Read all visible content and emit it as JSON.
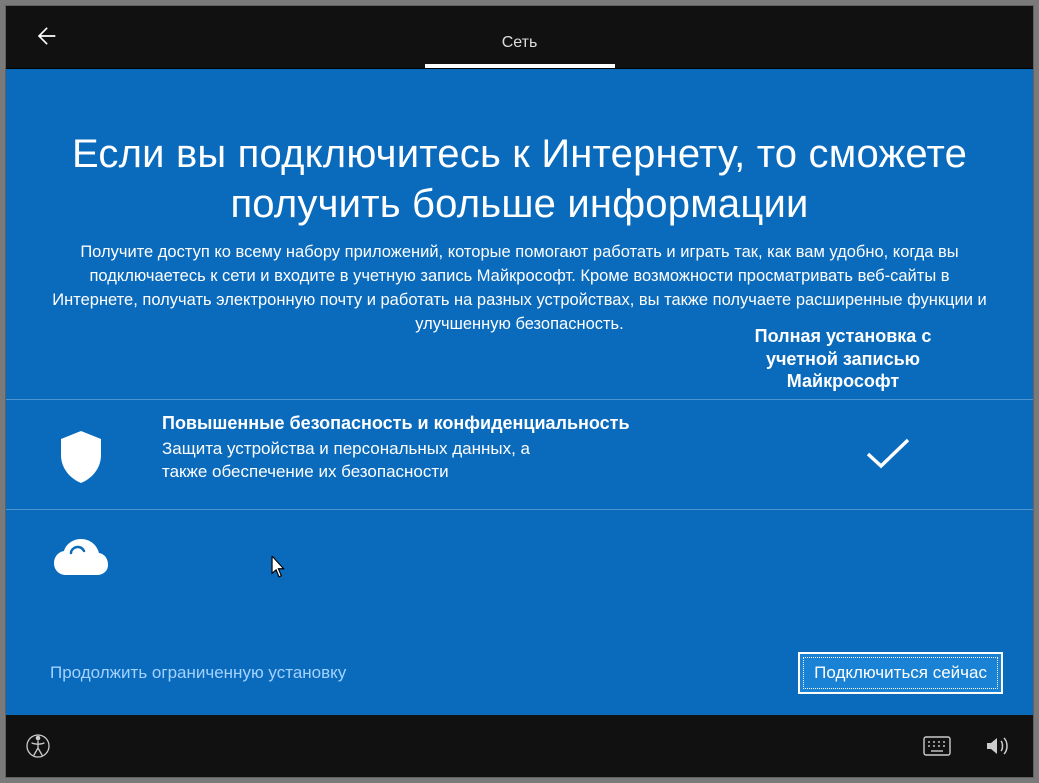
{
  "titlebar": {
    "tab_label": "Сеть"
  },
  "hero": {
    "heading": "Если вы подключитесь к Интернету, то сможете получить больше информации",
    "subtext": "Получите доступ ко всему набору приложений, которые помогают работать и играть так, как вам удобно, когда вы подключаетесь к сети и входите в учетную запись Майкрософт. Кроме возможности просматривать веб-сайты в Интернете, получать электронную почту и работать на разных устройствах, вы также получаете расширенные функции и улучшенную безопасность.",
    "column_header": "Полная установка с учетной записью Майкрософт"
  },
  "features": [
    {
      "icon": "shield-icon",
      "title": "Повышенные безопасность и конфиденциальность",
      "desc": "Защита устройства и персональных данных, а также обеспечение их безопасности",
      "checked": true
    },
    {
      "icon": "cloud-icon",
      "title": "",
      "desc": "",
      "checked": false
    }
  ],
  "actions": {
    "secondary_link": "Продолжить ограниченную установку",
    "primary_button": "Подключиться сейчас"
  },
  "icons": {
    "back": "back-arrow-icon",
    "accessibility": "accessibility-icon",
    "keyboard": "keyboard-icon",
    "volume": "volume-icon"
  }
}
